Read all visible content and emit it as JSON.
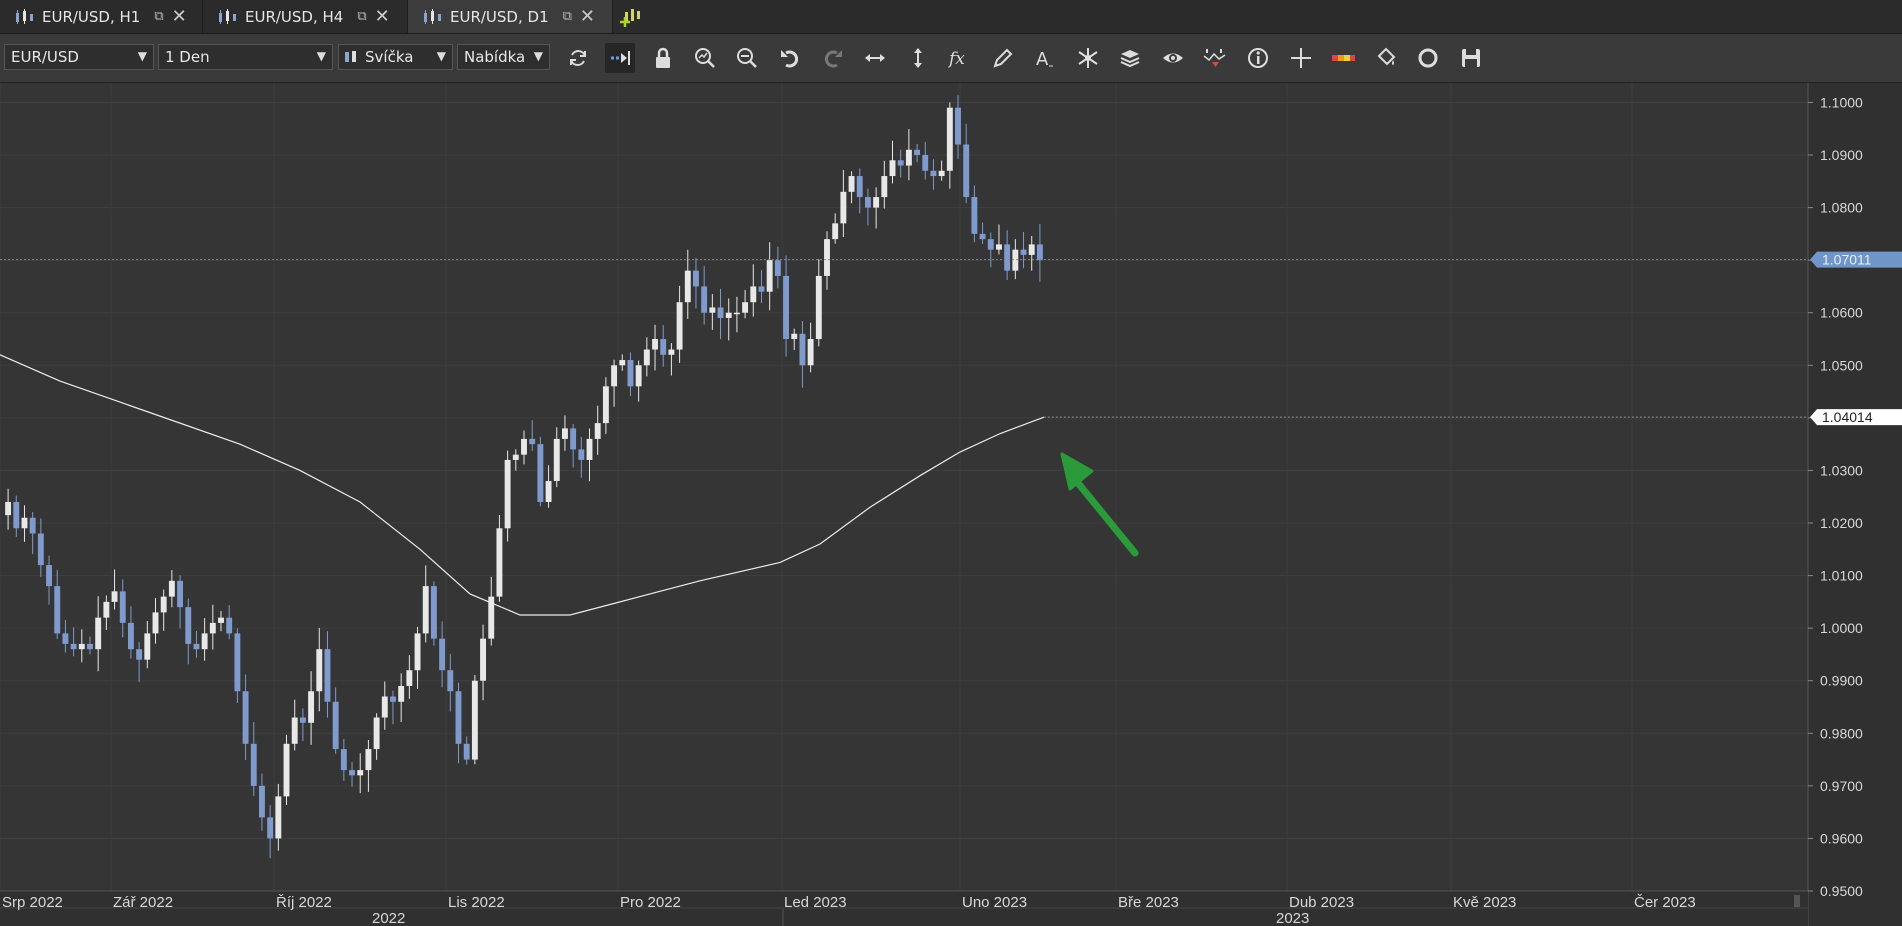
{
  "tabs": [
    {
      "label": "EUR/USD, H1",
      "active": false
    },
    {
      "label": "EUR/USD, H4",
      "active": false
    },
    {
      "label": "EUR/USD, D1",
      "active": true
    }
  ],
  "toolbar": {
    "instrument": "EUR/USD",
    "period": "1 Den",
    "chart_type": "Svíčka",
    "price_side": "Nabídka",
    "icons": [
      "refresh-icon",
      "shift-chart-icon",
      "lock-icon",
      "zoom-in-icon",
      "zoom-out-icon",
      "undo-icon",
      "redo-icon",
      "horizontal-scale-icon",
      "vertical-scale-icon",
      "indicators-fx-icon",
      "pencil-icon",
      "text-icon",
      "pattern-icon",
      "layers-icon",
      "eye-icon",
      "signals-icon",
      "info-icon",
      "crosshair-icon",
      "theme-colors-icon",
      "paint-bucket-icon",
      "reset-icon",
      "save-icon"
    ]
  },
  "chart_data": {
    "type": "candlestick",
    "ylim": [
      0.95,
      1.1037
    ],
    "y_ticks": [
      "1.1000",
      "1.0900",
      "1.0800",
      "1.0700",
      "1.0600",
      "1.0500",
      "1.0400",
      "1.0300",
      "1.0200",
      "1.0100",
      "1.0000",
      "0.9900",
      "0.9800",
      "0.9700",
      "0.9600",
      "0.9500"
    ],
    "x_ticks": [
      "Srp 2022",
      "Zář 2022",
      "Říj 2022",
      "Lis 2022",
      "Pro 2022",
      "Led 2023",
      "Uno 2023",
      "Bře 2023",
      "Dub 2023",
      "Kvě 2023",
      "Čer 2023"
    ],
    "year_labels": [
      "2022",
      "2023"
    ],
    "current_price_label": "1.07011",
    "ma_price_label": "1.04014",
    "candles_close": [
      1.024,
      1.019,
      1.021,
      1.018,
      1.012,
      1.008,
      0.999,
      0.997,
      0.996,
      0.997,
      0.996,
      1.002,
      1.005,
      1.007,
      1.001,
      0.996,
      0.994,
      0.999,
      1.003,
      1.006,
      1.009,
      1.004,
      0.997,
      0.996,
      0.999,
      1.001,
      1.002,
      0.999,
      0.988,
      0.978,
      0.97,
      0.964,
      0.96,
      0.968,
      0.978,
      0.983,
      0.982,
      0.988,
      0.996,
      0.986,
      0.977,
      0.973,
      0.972,
      0.973,
      0.977,
      0.983,
      0.987,
      0.986,
      0.989,
      0.992,
      0.999,
      1.008,
      0.998,
      0.992,
      0.988,
      0.978,
      0.975,
      0.99,
      0.998,
      1.006,
      1.019,
      1.032,
      1.033,
      1.036,
      1.035,
      1.024,
      1.028,
      1.036,
      1.038,
      1.034,
      1.032,
      1.036,
      1.039,
      1.046,
      1.05,
      1.051,
      1.046,
      1.05,
      1.053,
      1.055,
      1.052,
      1.053,
      1.062,
      1.068,
      1.065,
      1.06,
      1.061,
      1.059,
      1.06,
      1.06,
      1.062,
      1.065,
      1.064,
      1.07,
      1.067,
      1.055,
      1.056,
      1.05,
      1.055,
      1.067,
      1.074,
      1.077,
      1.083,
      1.086,
      1.082,
      1.08,
      1.082,
      1.086,
      1.089,
      1.088,
      1.091,
      1.09,
      1.087,
      1.086,
      1.087,
      1.099,
      1.092,
      1.082,
      1.075,
      1.074,
      1.072,
      1.073,
      1.068,
      1.072,
      1.071,
      1.073,
      1.07
    ]
  }
}
